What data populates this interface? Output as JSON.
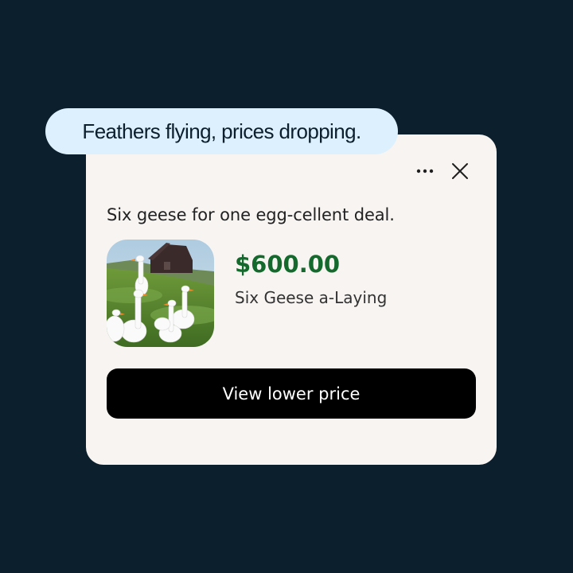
{
  "bubble": {
    "text": "Feathers flying, prices dropping."
  },
  "card": {
    "headline": "Six geese for one egg-cellent deal.",
    "price": "$600.00",
    "product_name": "Six Geese a-Laying",
    "cta_label": "View lower price",
    "icons": {
      "more": "more-horizontal-icon",
      "close": "close-icon"
    }
  },
  "colors": {
    "background": "#0c1f2d",
    "card": "#f7f4f1",
    "bubble": "#dcf1fd",
    "price": "#146a2d",
    "cta": "#000000"
  }
}
